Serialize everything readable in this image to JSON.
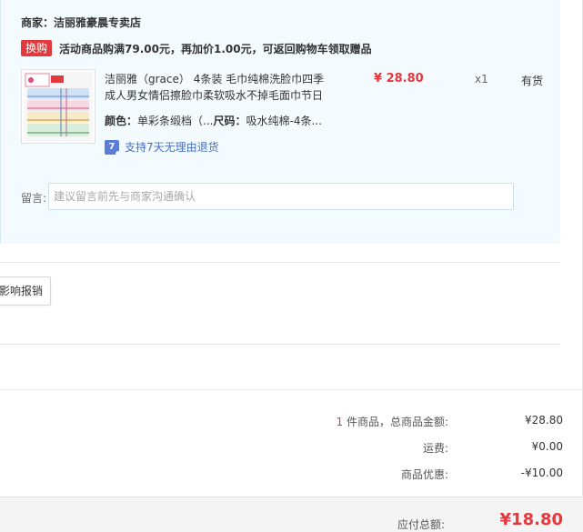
{
  "shop": {
    "merchant_label": "商家：洁丽雅豪晨专卖店",
    "promo_badge": "换购",
    "promo_text": "活动商品购满79.00元，再加价1.00元，可返回购物车领取赠品"
  },
  "product": {
    "thumb_icon": "towel-product-image",
    "title": "洁丽雅（grace） 4条装 毛巾纯棉洗脸巾四季成人男女情侣擦脸巾柔软吸水不掉毛面巾节日",
    "price": "¥ 28.80",
    "quantity": "x1",
    "stock": "有货",
    "color_label": "颜色：",
    "color_value": "单彩条缎档（...",
    "size_label": "尺码：",
    "size_value": "吸水纯棉-4条...",
    "return_icon": "7",
    "return_text": "支持7天无理由退货"
  },
  "message": {
    "label": "留言:",
    "placeholder": "建议留言前先与商家沟通确认"
  },
  "reimburse_button": "影响报销",
  "summary": {
    "count": "1",
    "goods_label": " 件商品，总商品金额:",
    "goods_value": "¥28.80",
    "shipping_label": "运费:",
    "shipping_value": "¥0.00",
    "discount_label": "商品优惠:",
    "discount_value": "-¥10.00",
    "total_label": "应付总额:",
    "total_value": "¥18.80"
  },
  "colors": {
    "accent_red": "#e4393c",
    "panel_blue": "#f3fbfe",
    "link_blue": "#4a6fc0"
  }
}
